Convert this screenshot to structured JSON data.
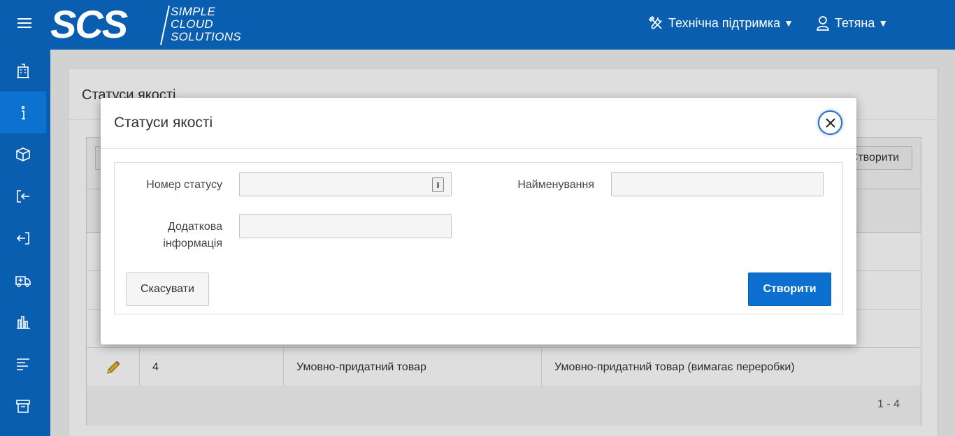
{
  "header": {
    "logo_mark": "SCS",
    "logo_lines": [
      "SIMPLE",
      "CLOUD",
      "SOLUTIONS"
    ],
    "support_label": "Технічна підтримка",
    "user_label": "Тетяна",
    "caret": "▼"
  },
  "sidebar": {
    "items": [
      {
        "icon": "building-icon"
      },
      {
        "icon": "info-icon",
        "active": true
      },
      {
        "icon": "box-icon"
      },
      {
        "icon": "sign-in-icon"
      },
      {
        "icon": "sign-out-icon"
      },
      {
        "icon": "ambulance-icon"
      },
      {
        "icon": "bar-chart-icon"
      },
      {
        "icon": "list-icon"
      },
      {
        "icon": "archive-icon"
      }
    ]
  },
  "page": {
    "title": "Статуси якості",
    "create_label": "Створити",
    "visible_row": {
      "number": "4",
      "name": "Умовно-придатний товар",
      "info": "Умовно-придатний товар (вимагає переробки)"
    },
    "pagination": "1 - 4"
  },
  "modal": {
    "title": "Статуси якості",
    "fields": {
      "number_label": "Номер статусу",
      "number_value": "",
      "name_label": "Найменування",
      "name_value": "",
      "info_label_line1": "Додаткова",
      "info_label_line2": "інформація",
      "info_value": ""
    },
    "cancel_label": "Скасувати",
    "create_label": "Створити"
  },
  "colors": {
    "brand": "#0a5eb0",
    "primary_button": "#0d6fd0"
  }
}
